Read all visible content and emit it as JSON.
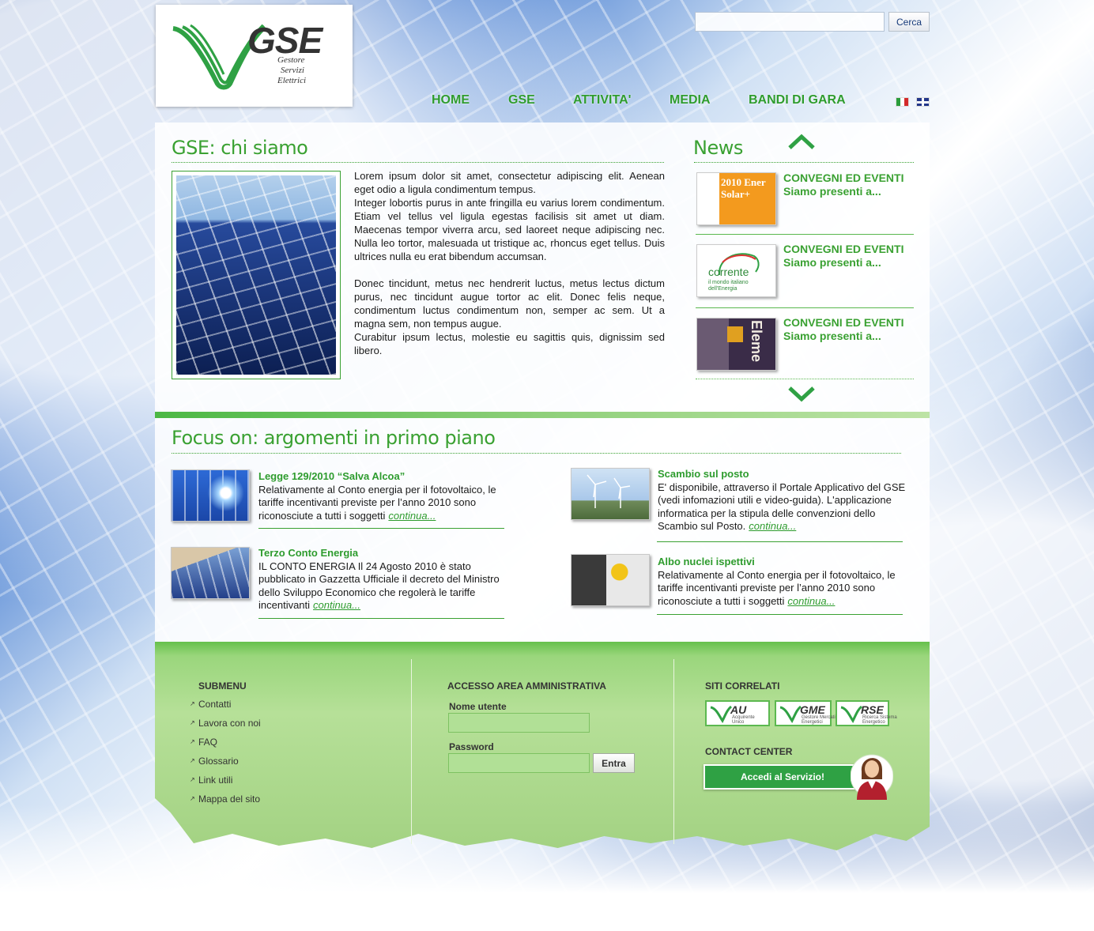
{
  "header": {
    "logo": {
      "name": "GSE",
      "sub": [
        "Gestore",
        "Servizi",
        "Elettrici"
      ]
    },
    "search": {
      "placeholder": "",
      "button_label": "Cerca"
    },
    "nav": [
      {
        "label": "HOME"
      },
      {
        "label": "GSE"
      },
      {
        "label": "ATTIVITA'"
      },
      {
        "label": "MEDIA"
      },
      {
        "label": "BANDI DI GARA"
      }
    ],
    "languages": [
      "italian-flag-icon",
      "english-flag-icon"
    ]
  },
  "about": {
    "title": "GSE: chi siamo",
    "paragraphs": [
      "Lorem ipsum dolor sit amet, consectetur adipiscing elit. Aenean eget odio a ligula condimentum tempus.",
      "Integer lobortis purus in ante fringilla eu varius lorem condimentum. Etiam vel tellus vel ligula egestas facilisis sit amet ut diam. Maecenas tempor viverra arcu, sed laoreet neque adipiscing nec. Nulla leo tortor, malesuada ut tristique ac, rhoncus eget tellus. Duis ultrices nulla eu erat bibendum accumsan.",
      "Donec tincidunt, metus nec hendrerit luctus, metus lectus dictum purus, nec tincidunt augue tortor ac elit. Donec felis neque, condimentum luctus condimentum non, semper ac sem. Ut a magna sem, non tempus augue.",
      "Curabitur ipsum lectus, molestie eu sagittis quis, dignissim sed libero."
    ]
  },
  "news": {
    "title": "News",
    "items": [
      {
        "category": "CONVEGNI ED EVENTI",
        "text": "Siamo presenti a...",
        "thumb_text": "2010 Ener Solar+"
      },
      {
        "category": "CONVEGNI ED EVENTI",
        "text": "Siamo presenti a...",
        "thumb_text": "corrente",
        "thumb_sub": "il mondo italiano dell'Energia"
      },
      {
        "category": "CONVEGNI ED EVENTI",
        "text": "Siamo presenti a...",
        "thumb_text": "Eleme"
      }
    ]
  },
  "focus": {
    "title": "Focus on: argomenti in primo piano",
    "more_label": "continua...",
    "items": [
      {
        "title": "Legge 129/2010 “Salva Alcoa”",
        "text": "Relativamente al Conto energia per il fotovoltaico, le tariffe incentivanti previste per l’anno 2010 sono riconosciute a tutti i soggetti"
      },
      {
        "title": "Terzo Conto Energia",
        "text": "IL CONTO ENERGIA Il 24 Agosto 2010 è stato pubblicato in Gazzetta Ufficiale il decreto del Ministro dello Sviluppo Economico che regolerà le tariffe incentivanti"
      },
      {
        "title": "Scambio sul posto",
        "text": "E' disponibile, attraverso il Portale Applicativo del GSE (vedi infomazioni utili e video-guida). L'applicazione informatica per la stipula delle convenzioni dello Scambio sul Posto."
      },
      {
        "title": "Albo nuclei ispettivi",
        "text": "Relativamente al Conto energia per il fotovoltaico, le tariffe incentivanti previste per l’anno 2010 sono riconosciute a tutti i soggetti"
      }
    ]
  },
  "footer": {
    "submenu": {
      "title": "SUBMENU",
      "items": [
        "Contatti",
        "Lavora con noi",
        "FAQ",
        "Glossario",
        "Link utili",
        "Mappa del sito"
      ]
    },
    "login": {
      "title": "ACCESSO AREA AMMINISTRATIVA",
      "username_label": "Nome utente",
      "password_label": "Password",
      "button_label": "Entra"
    },
    "related": {
      "title": "SITI CORRELATI",
      "sites": [
        {
          "abbr": "AU",
          "sub": "Acquirente Unico"
        },
        {
          "abbr": "GME",
          "sub": "Gestore Mercati Energetici"
        },
        {
          "abbr": "RSE",
          "sub": "Ricerca Sistema Energetico"
        }
      ]
    },
    "contact": {
      "title": "CONTACT CENTER",
      "button_label": "Accedi al Servizio!"
    }
  },
  "colors": {
    "brand_green": "#3aa132",
    "button_green": "#2fa144",
    "footer_green": "#9fd27f"
  }
}
